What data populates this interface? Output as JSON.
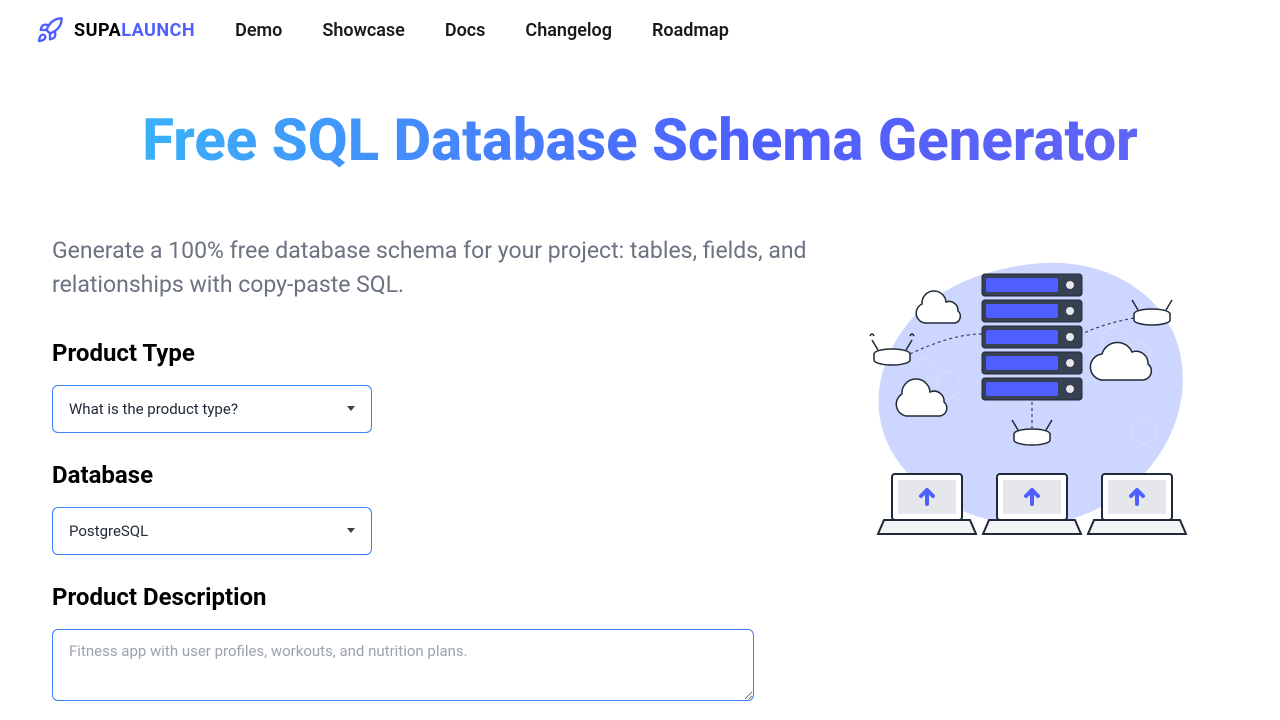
{
  "brand": {
    "part1": "SUPA",
    "part2": "LAUNCH"
  },
  "nav": [
    "Demo",
    "Showcase",
    "Docs",
    "Changelog",
    "Roadmap"
  ],
  "hero": {
    "title": "Free SQL Database Schema Generator"
  },
  "subtitle": "Generate a 100% free database schema for your project: tables, fields, and relationships with copy-paste SQL.",
  "form": {
    "product_type_label": "Product Type",
    "product_type_value": "What is the product type?",
    "database_label": "Database",
    "database_value": "PostgreSQL",
    "description_label": "Product Description",
    "description_placeholder": "Fitness app with user profiles, workouts, and nutrition plans."
  }
}
